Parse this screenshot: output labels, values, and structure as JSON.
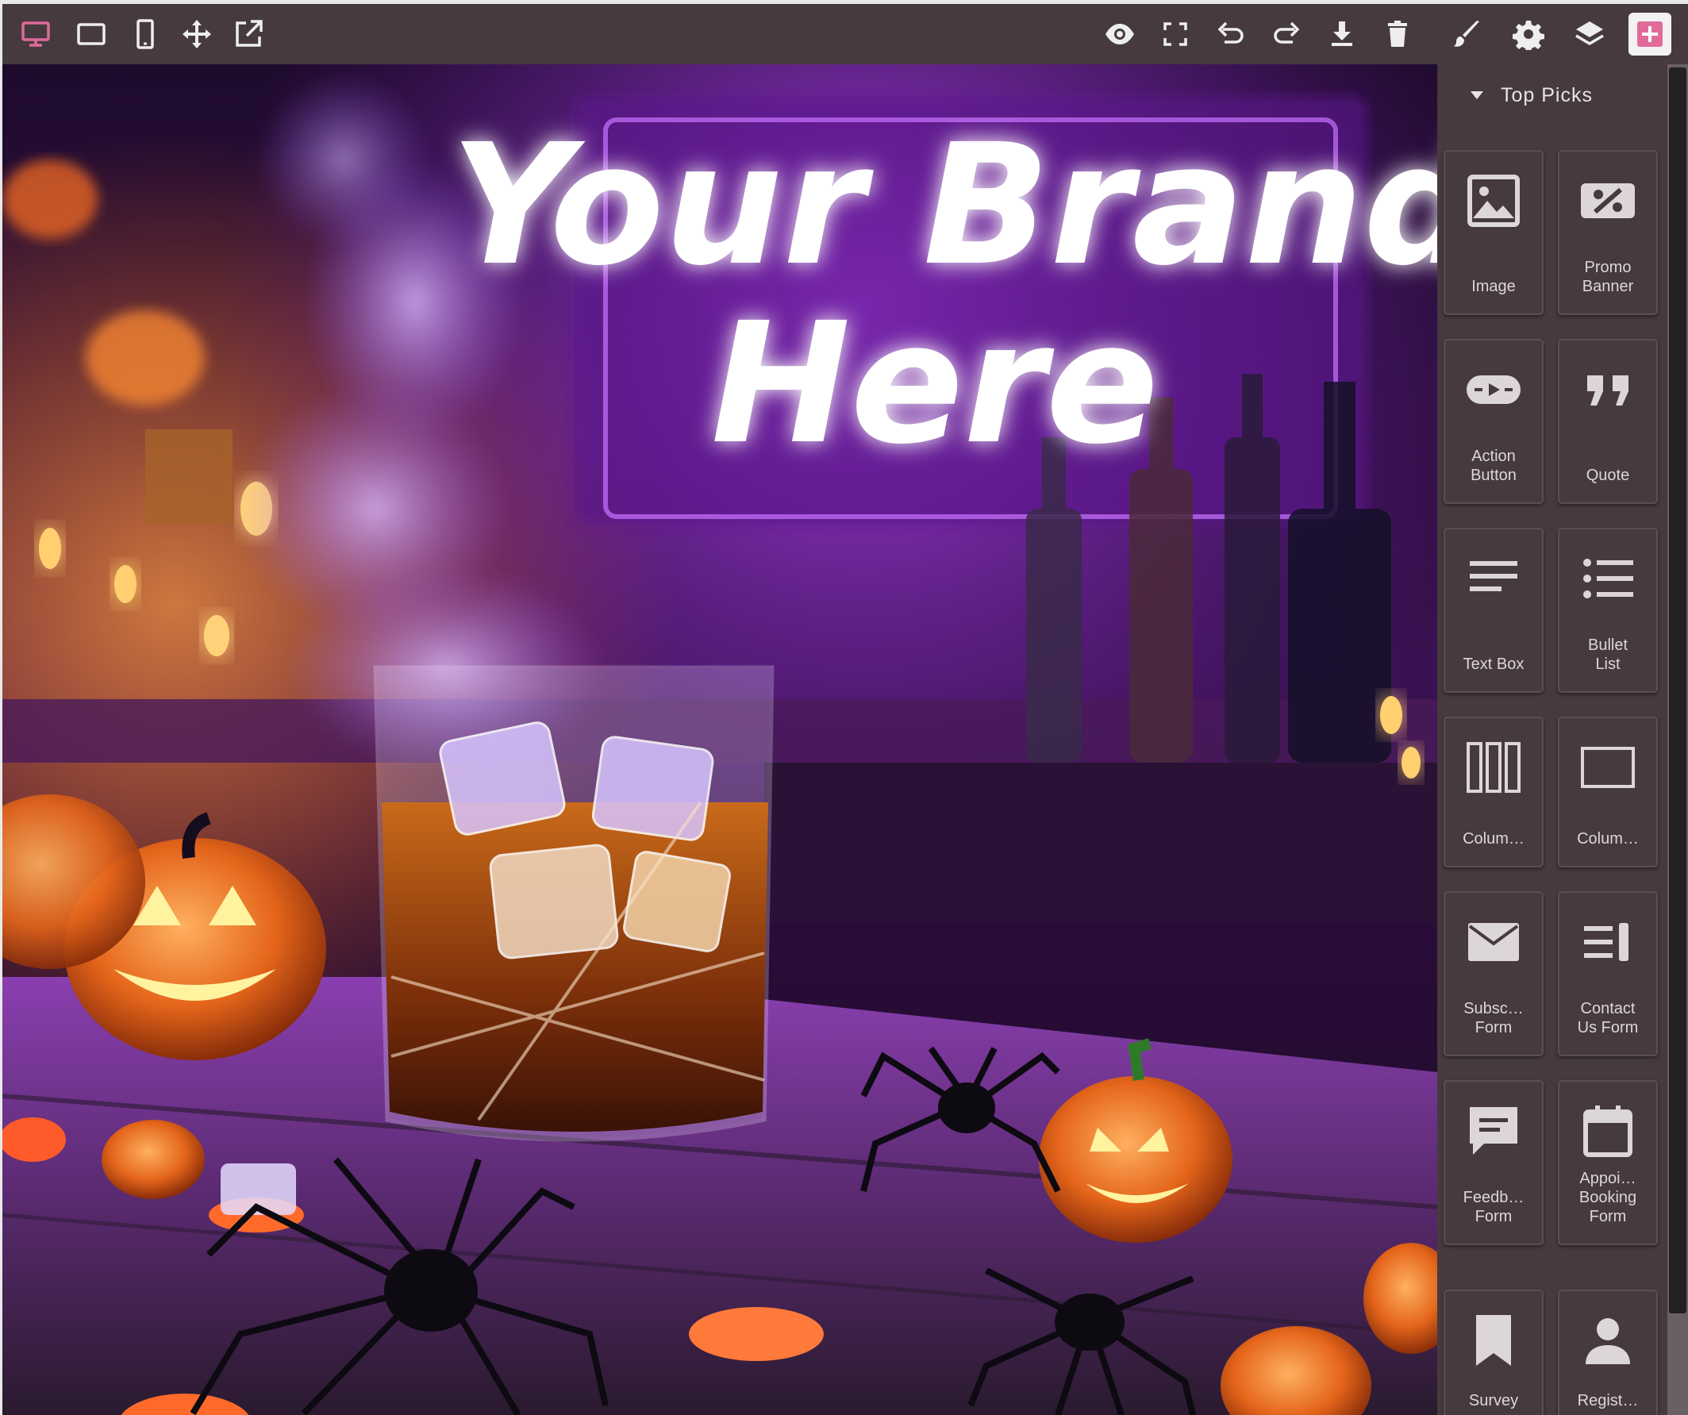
{
  "toolbar": {
    "left_icons": [
      "desktop-icon",
      "tablet-landscape-icon",
      "mobile-icon",
      "move-icon",
      "open-external-icon"
    ],
    "right_icons": [
      "preview-eye-icon",
      "fullscreen-icon",
      "undo-icon",
      "redo-icon",
      "download-icon",
      "trash-icon",
      "paint-brush-icon",
      "settings-gear-icon",
      "layers-icon",
      "add-block-icon"
    ],
    "active_color": "#e06b9a"
  },
  "canvas": {
    "headline_line1": "Your Brand",
    "headline_line2": "Here",
    "neon_color": "#b044ff"
  },
  "panel": {
    "section_title": "Top Picks",
    "blocks": [
      {
        "label": "Image",
        "icon": "image-icon"
      },
      {
        "label": "Promo\nBanner",
        "icon": "promo-banner-icon"
      },
      {
        "label": "Action\nButton",
        "icon": "action-button-icon"
      },
      {
        "label": "Quote",
        "icon": "quote-icon"
      },
      {
        "label": "Text Box",
        "icon": "text-box-icon"
      },
      {
        "label": "Bullet\nList",
        "icon": "bullet-list-icon"
      },
      {
        "label": "Colum…",
        "icon": "three-columns-icon"
      },
      {
        "label": "Colum…",
        "icon": "one-column-icon"
      },
      {
        "label": "Subsc…\nForm",
        "icon": "envelope-icon"
      },
      {
        "label": "Contact\nUs Form",
        "icon": "contact-form-icon"
      },
      {
        "label": "Feedb…\nForm",
        "icon": "feedback-icon"
      },
      {
        "label": "Appoi…\nBooking\nForm",
        "icon": "calendar-icon"
      },
      {
        "label": "Survey",
        "icon": "bookmark-icon"
      },
      {
        "label": "Regist…",
        "icon": "person-icon"
      }
    ]
  }
}
